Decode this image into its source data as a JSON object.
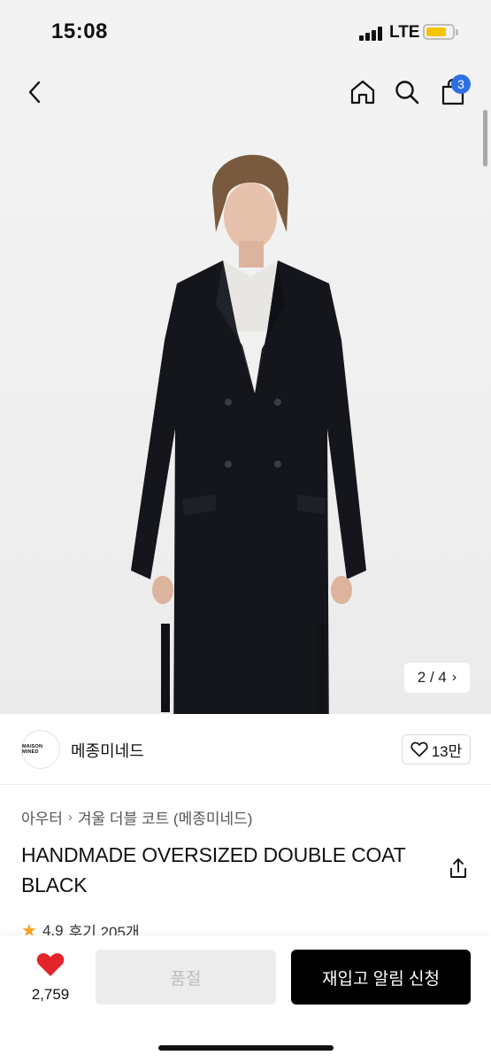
{
  "status_bar": {
    "time": "15:08",
    "network": "LTE"
  },
  "nav": {
    "cart_count": "3"
  },
  "gallery": {
    "current": "2",
    "total": "4",
    "counter_text": "2 / 4"
  },
  "brand": {
    "name": "메종미네드",
    "logo_text": "MAISON MINED",
    "likes": "13만"
  },
  "product": {
    "breadcrumb": [
      "아우터",
      "겨울 더블 코트 (메종미네드)"
    ],
    "title": "HANDMADE OVERSIZED DOUBLE COAT BLACK",
    "rating": "4.9",
    "reviews": "후기 205개"
  },
  "bottom_bar": {
    "wishlist_count": "2,759",
    "soldout_label": "품절",
    "restock_label": "재입고 알림 신청"
  },
  "colors": {
    "accent_badge": "#2f6fe6",
    "heart": "#e3242b",
    "cta": "#000000",
    "star": "#f5a623"
  }
}
